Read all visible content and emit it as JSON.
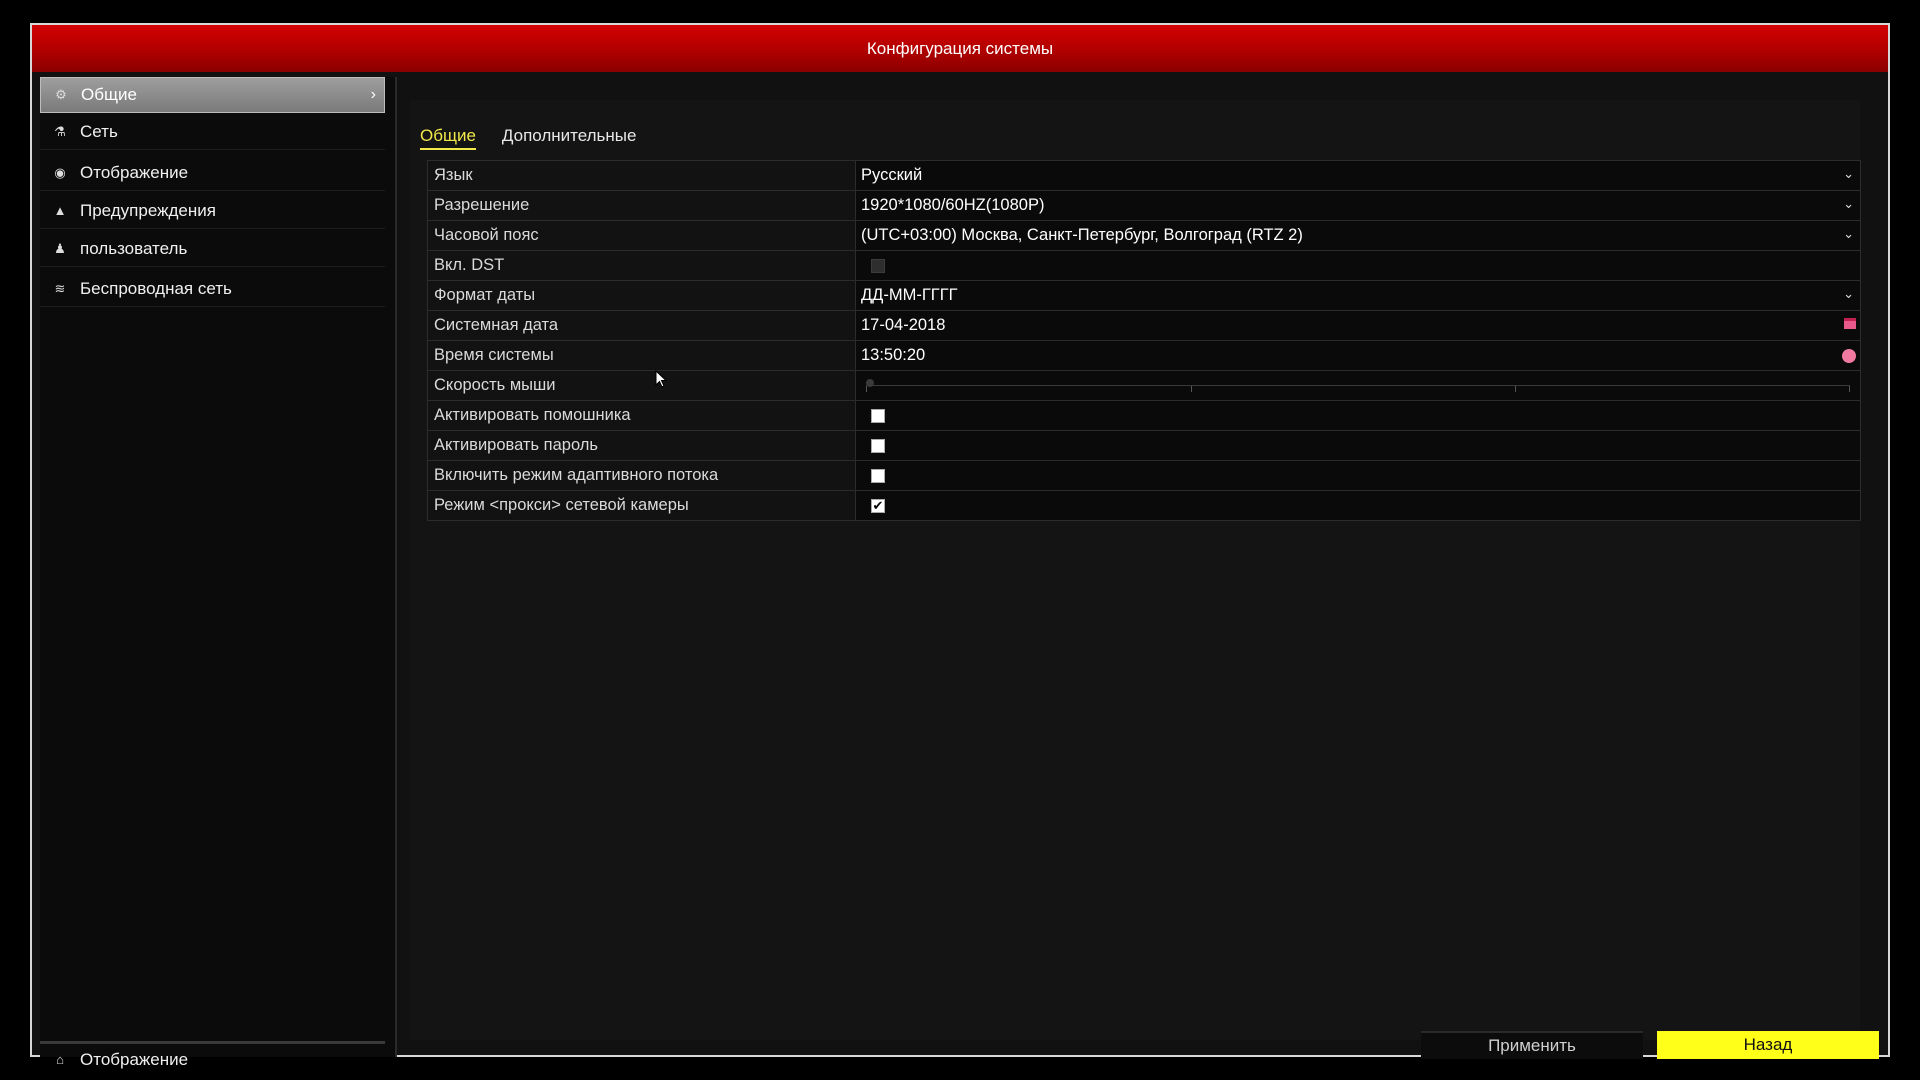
{
  "window": {
    "title": "Конфигурация системы"
  },
  "sidebar": {
    "items": [
      {
        "label": "Общие",
        "icon": "gear-icon",
        "active": true
      },
      {
        "label": "Сеть",
        "icon": "network-icon"
      },
      {
        "label": "Отображение",
        "icon": "eye-icon"
      },
      {
        "label": "Предупреждения",
        "icon": "warning-icon"
      },
      {
        "label": "пользователь",
        "icon": "users-icon"
      },
      {
        "label": "Беспроводная сеть",
        "icon": "wifi-icon"
      }
    ],
    "bottom": {
      "label": "Отображение",
      "icon": "home-icon"
    }
  },
  "tabs": [
    {
      "label": "Общие",
      "active": true
    },
    {
      "label": "Дополнительные"
    }
  ],
  "settings": {
    "language": {
      "label": "Язык",
      "value": "Русский"
    },
    "resolution": {
      "label": "Разрешение",
      "value": "1920*1080/60HZ(1080P)"
    },
    "timezone": {
      "label": "Часовой пояс",
      "value": "(UTC+03:00) Москва, Санкт-Петербург, Волгоград (RTZ 2)"
    },
    "dst": {
      "label": "Вкл. DST",
      "checked": false,
      "disabled": true
    },
    "date_format": {
      "label": "Формат даты",
      "value": "ДД-ММ-ГГГГ"
    },
    "system_date": {
      "label": "Системная дата",
      "value": "17-04-2018"
    },
    "system_time": {
      "label": "Время системы",
      "value": "13:50:20"
    },
    "mouse_speed": {
      "label": "Скорость мыши",
      "level": 0
    },
    "wizard": {
      "label": "Активировать помошника",
      "checked": false
    },
    "password": {
      "label": "Активировать пароль",
      "checked": false
    },
    "adaptive_stream": {
      "label": "Включить режим адаптивного потока",
      "checked": false
    },
    "proxy_mode": {
      "label": "Режим <прокси> сетевой камеры",
      "checked": true
    }
  },
  "buttons": {
    "apply": "Применить",
    "back": "Назад"
  },
  "colors": {
    "title_red": "#c00000",
    "accent_yellow": "#ffff1a",
    "tab_active": "#f2e84a"
  }
}
